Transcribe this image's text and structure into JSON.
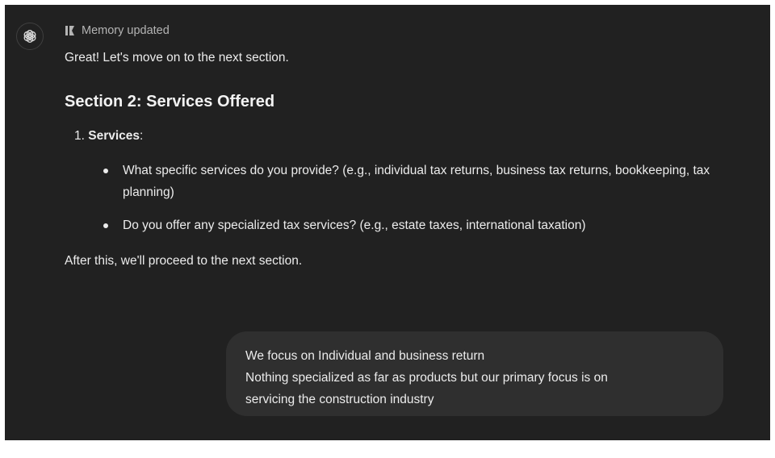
{
  "assistant": {
    "avatar_icon": "openai-logo-icon",
    "memory_icon": "memory-icon",
    "memory_label": "Memory updated",
    "greeting": "Great! Let's move on to the next section.",
    "section_title": "Section 2: Services Offered",
    "list_number": "1.",
    "list_item_title": "Services",
    "list_item_colon": ":",
    "bullets": [
      "What specific services do you provide? (e.g., individual tax returns, business tax returns, bookkeeping, tax planning)",
      "Do you offer any specialized tax services? (e.g., estate taxes, international taxation)"
    ],
    "closing": "After this, we'll proceed to the next section."
  },
  "user_message": {
    "lines": [
      "We focus on Individual and business return",
      "Nothing specialized as far as products but our primary focus is on",
      "servicing the construction industry"
    ]
  },
  "colors": {
    "background": "#212121",
    "bubble": "#2f2f2f",
    "text": "#ececec",
    "muted": "#b4b4b4"
  }
}
